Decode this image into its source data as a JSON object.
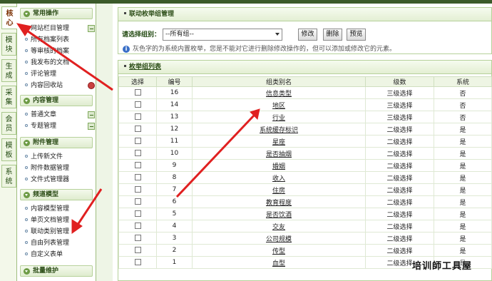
{
  "vertical_tabs": [
    "核心",
    "模块",
    "生成",
    "采集",
    "会员",
    "模板",
    "系统"
  ],
  "sidebar": {
    "sections": [
      {
        "title": "常用操作",
        "items": [
          {
            "label": "网站栏目管理",
            "icon": "add-icon"
          },
          {
            "label": "所有档案列表",
            "icon": ""
          },
          {
            "label": "等审核的档案",
            "icon": ""
          },
          {
            "label": "我发布的文档",
            "icon": ""
          },
          {
            "label": "评论管理",
            "icon": ""
          },
          {
            "label": "内容回收站",
            "icon": "trash-icon"
          }
        ]
      },
      {
        "title": "内容管理",
        "items": [
          {
            "label": "普通文章",
            "icon": "add-icon"
          },
          {
            "label": "专题管理",
            "icon": "add-icon"
          }
        ]
      },
      {
        "title": "附件管理",
        "items": [
          {
            "label": "上传新文件",
            "icon": ""
          },
          {
            "label": "附件数据管理",
            "icon": ""
          },
          {
            "label": "文件式管理器",
            "icon": ""
          }
        ]
      },
      {
        "title": "频道模型",
        "items": [
          {
            "label": "内容模型管理",
            "icon": ""
          },
          {
            "label": "单页文档管理",
            "icon": ""
          },
          {
            "label": "联动类别管理",
            "icon": ""
          },
          {
            "label": "自由列表管理",
            "icon": ""
          },
          {
            "label": "自定义表单",
            "icon": ""
          }
        ]
      },
      {
        "title": "批量维护",
        "items": []
      }
    ]
  },
  "panel1": {
    "title": "联动枚举组管理",
    "filter_label": "请选择组别：",
    "select_value": "--所有组--",
    "buttons": [
      "修改",
      "删除",
      "预览"
    ],
    "note": "灰色字的为系统内置枚举，您是不能对它进行删除修改操作的，但可以添加或修改它的元素。"
  },
  "panel2": {
    "title": "枚举组列表",
    "columns": [
      "选择",
      "编号",
      "组类别名",
      "级数",
      "系统"
    ],
    "rows": [
      [
        "16",
        "信息类型",
        "三级选择",
        "否"
      ],
      [
        "14",
        "地区",
        "三级选择",
        "否"
      ],
      [
        "13",
        "行业",
        "三级选择",
        "否"
      ],
      [
        "12",
        "系统缓存标识",
        "二级选择",
        "是"
      ],
      [
        "11",
        "星座",
        "二级选择",
        "是"
      ],
      [
        "10",
        "是否抽烟",
        "二级选择",
        "是"
      ],
      [
        "9",
        "婚姻",
        "二级选择",
        "是"
      ],
      [
        "8",
        "收入",
        "二级选择",
        "是"
      ],
      [
        "7",
        "住房",
        "二级选择",
        "是"
      ],
      [
        "6",
        "教育程度",
        "二级选择",
        "是"
      ],
      [
        "5",
        "是否饮酒",
        "二级选择",
        "是"
      ],
      [
        "4",
        "交友",
        "二级选择",
        "是"
      ],
      [
        "3",
        "公司规模",
        "二级选择",
        "是"
      ],
      [
        "2",
        "传型",
        "二级选择",
        "是"
      ],
      [
        "1",
        "血型",
        "二级选择",
        "是"
      ]
    ]
  },
  "watermark": "培训師工具屋",
  "accent_color": "#e02020"
}
